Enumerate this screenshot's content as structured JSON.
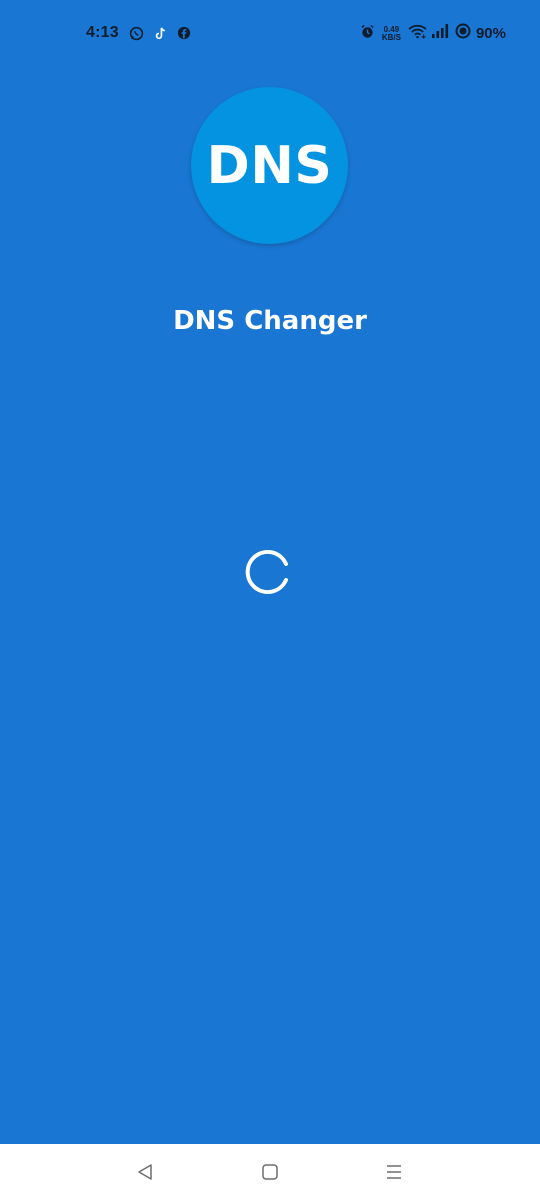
{
  "status_bar": {
    "time": "4:13",
    "notifications": [
      "whatsapp-icon",
      "tiktok-icon",
      "facebook-icon"
    ],
    "speed_value": "0.49",
    "speed_unit": "KB/S",
    "battery": "90%"
  },
  "app": {
    "logo_text": "DNS",
    "title": "DNS Changer",
    "background_color": "#1976D2",
    "logo_color": "#0493E0"
  },
  "navigation": {
    "buttons": [
      "back",
      "home",
      "recents"
    ]
  }
}
